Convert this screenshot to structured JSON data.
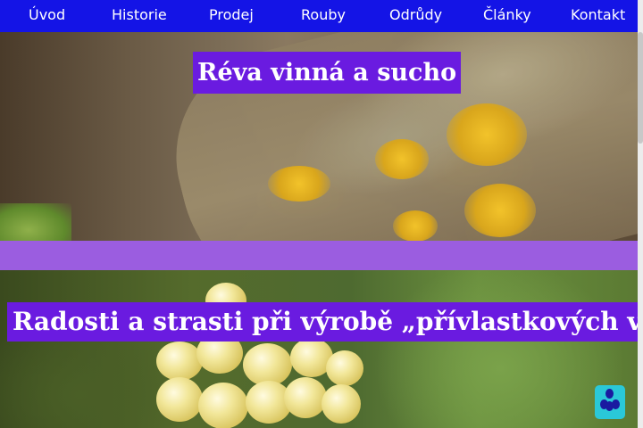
{
  "nav": {
    "items": [
      {
        "label": "Úvod"
      },
      {
        "label": "Historie"
      },
      {
        "label": "Prodej"
      },
      {
        "label": "Rouby"
      },
      {
        "label": "Odrůdy"
      },
      {
        "label": "Články"
      },
      {
        "label": "Kontakt"
      }
    ]
  },
  "sections": [
    {
      "title": "Réva vinná a sucho"
    },
    {
      "title": "Radosti a strasti při výrobě „přívlastkových vín“"
    }
  ],
  "colors": {
    "nav_bg": "#1414e6",
    "title_bg": "#6a1be0",
    "band": "#9b5de0",
    "badge": "#2ac8d8"
  },
  "icons": {
    "badge": "app-badge-icon"
  }
}
